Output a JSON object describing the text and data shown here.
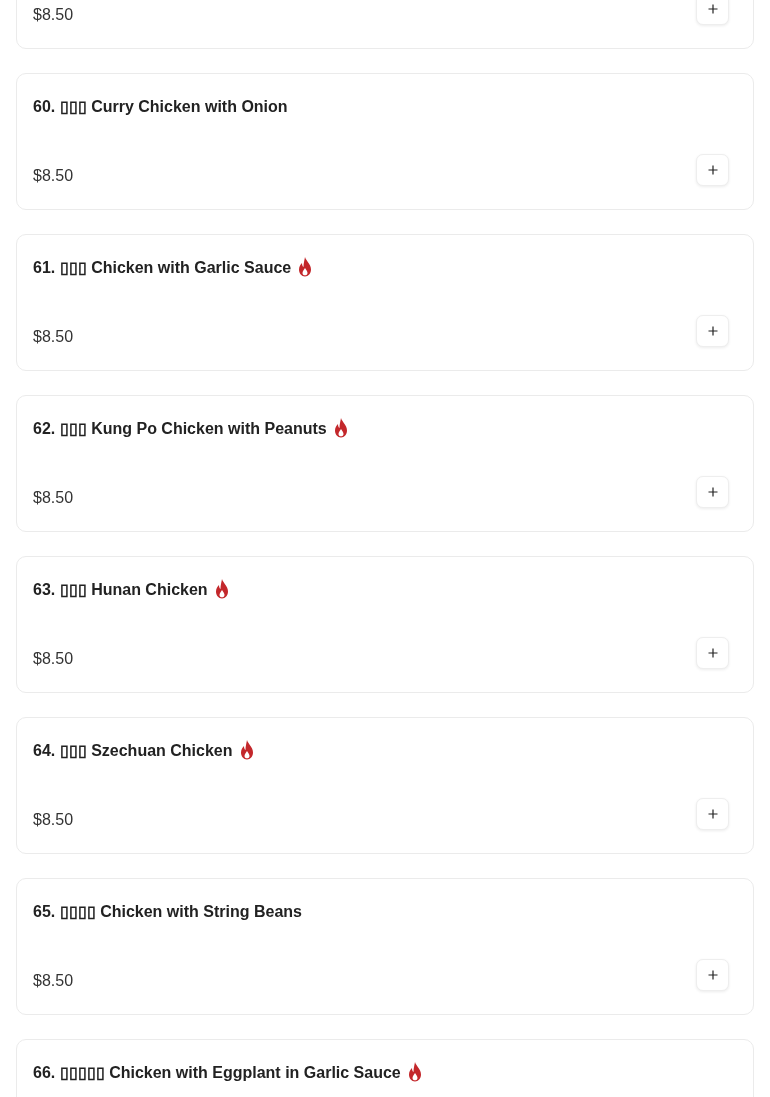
{
  "items": [
    {
      "price": "$8.50"
    },
    {
      "name": "60. ▯▯▯ Curry Chicken with Onion",
      "price": "$8.50",
      "spicy": false
    },
    {
      "name": "61. ▯▯▯ Chicken with Garlic Sauce",
      "price": "$8.50",
      "spicy": true
    },
    {
      "name": "62. ▯▯▯ Kung Po Chicken with Peanuts",
      "price": "$8.50",
      "spicy": true
    },
    {
      "name": "63. ▯▯▯ Hunan Chicken",
      "price": "$8.50",
      "spicy": true
    },
    {
      "name": "64. ▯▯▯ Szechuan Chicken",
      "price": "$8.50",
      "spicy": true
    },
    {
      "name": "65. ▯▯▯▯ Chicken with String Beans",
      "price": "$8.50",
      "spicy": false
    },
    {
      "name": "66. ▯▯▯▯▯ Chicken with Eggplant in Garlic Sauce",
      "spicy": true
    }
  ]
}
